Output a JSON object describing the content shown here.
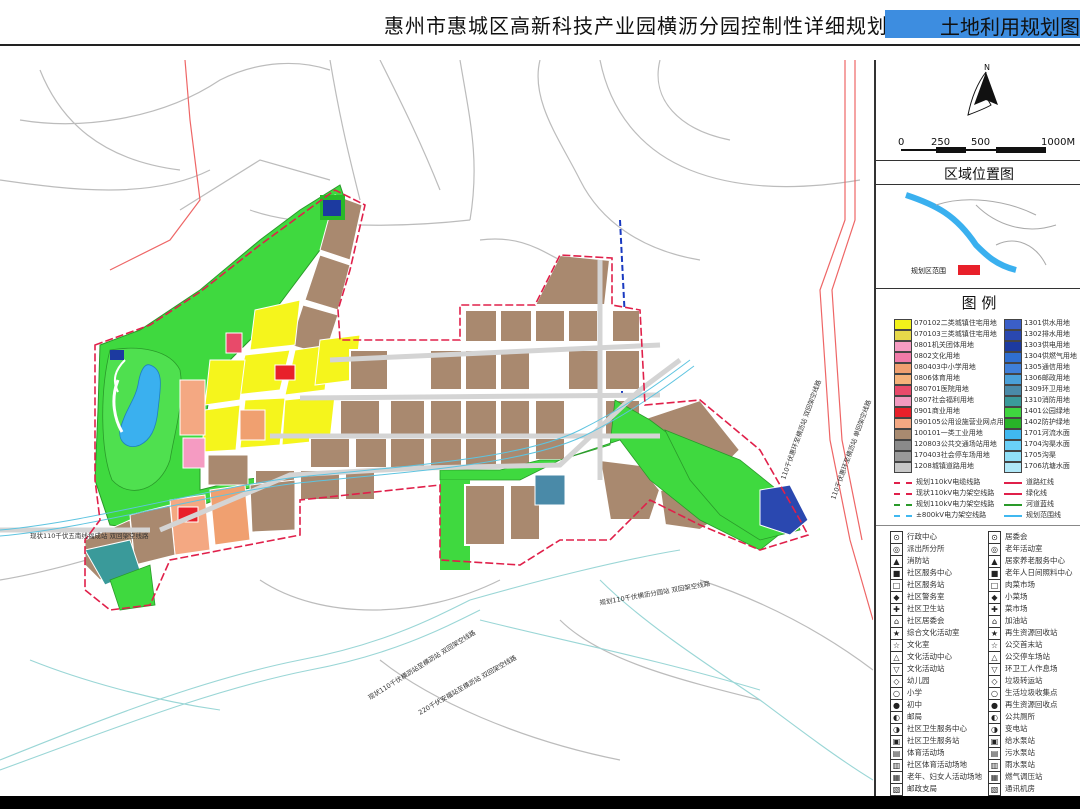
{
  "header": {
    "title": "惠州市惠城区高新科技产业园横沥分园控制性详细规划",
    "sheet_name": "土地利用规划图"
  },
  "scale": {
    "ticks": [
      "0",
      "250",
      "500",
      "1000M"
    ],
    "north_label": "N"
  },
  "location": {
    "title": "区域位置图",
    "range_label": "规划区范围"
  },
  "legend": {
    "title": "图  例",
    "left_items": [
      {
        "label": "070102二类城镇住宅用地",
        "color": "#f2f21a"
      },
      {
        "label": "070103三类城镇住宅用地",
        "color": "#e6d84a"
      },
      {
        "label": "0801机关团体用地",
        "color": "#f59bc2"
      },
      {
        "label": "0802文化用地",
        "color": "#f07aa8"
      },
      {
        "label": "080403中小学用地",
        "color": "#f0a070"
      },
      {
        "label": "0806体育用地",
        "color": "#f5b27a"
      },
      {
        "label": "080701医院用地",
        "color": "#e84a6a"
      },
      {
        "label": "0807社会福利用地",
        "color": "#f29ac0"
      },
      {
        "label": "0901商业用地",
        "color": "#e8202a"
      },
      {
        "label": "090105公用设施营业网点用地",
        "color": "#f4a882"
      },
      {
        "label": "100101一类工业用地",
        "color": "#a88a70"
      },
      {
        "label": "120803公共交通场站用地",
        "color": "#8a8a8a"
      },
      {
        "label": "170403社会停车场用地",
        "color": "#9a9a9a"
      },
      {
        "label": "1208城镇道路用地",
        "color": "#c8c8c8"
      }
    ],
    "right_items": [
      {
        "label": "1301供水用地",
        "color": "#3b5fc8"
      },
      {
        "label": "1302排水用地",
        "color": "#2a48b0"
      },
      {
        "label": "1303供电用地",
        "color": "#1c3aa0"
      },
      {
        "label": "1304供燃气用地",
        "color": "#2f6fd0"
      },
      {
        "label": "1305通信用地",
        "color": "#3f7fd8"
      },
      {
        "label": "1306邮政用地",
        "color": "#4aa0d8"
      },
      {
        "label": "1309环卫用地",
        "color": "#4a8aa8"
      },
      {
        "label": "1310消防用地",
        "color": "#3a9a9a"
      },
      {
        "label": "1401公园绿地",
        "color": "#3fd43f"
      },
      {
        "label": "1402防护绿地",
        "color": "#28b428"
      },
      {
        "label": "1701河流水面",
        "color": "#40b8f0"
      },
      {
        "label": "1704沟渠水面",
        "color": "#6ad0f8"
      },
      {
        "label": "1705沟渠",
        "color": "#90e0f8"
      },
      {
        "label": "1706坑塘水面",
        "color": "#b0e8f8"
      }
    ],
    "line_items_left": [
      "规划110kV电缆线路",
      "现状110kV电力架空线路",
      "规划110kV电力架空线路",
      "±800kV电力架空线路"
    ],
    "line_items_right": [
      "道路红线",
      "绿化线",
      "河道蓝线",
      "规划范围线"
    ],
    "symbols_left": [
      "行政中心",
      "派出所分所",
      "消防站",
      "社区服务中心",
      "社区服务站",
      "社区警务室",
      "社区卫生站",
      "社区居委会",
      "综合文化活动室",
      "文化室",
      "文化活动中心",
      "文化活动站",
      "幼儿园",
      "小学",
      "初中",
      "邮局",
      "社区卫生服务中心",
      "社区卫生服务站",
      "体育活动场",
      "社区体育活动场地",
      "老年、妇女人活动场地",
      "邮政支局"
    ],
    "symbols_right": [
      "居委会",
      "老年活动室",
      "居家养老服务中心",
      "老年人日间照料中心",
      "肉菜市场",
      "小菜场",
      "菜市场",
      "加油站",
      "再生资源回收站",
      "公交首末站",
      "公交停车场站",
      "环卫工人作息场",
      "垃圾转运站",
      "生活垃圾收集点",
      "再生资源回收点",
      "公共厕所",
      "变电站",
      "给水泵站",
      "污水泵站",
      "雨水泵站",
      "燃气调压站",
      "通讯机房"
    ]
  },
  "map_labels": {
    "road_1": "现状110千伏五南线福成站  双回架空线路",
    "road_2": "现状110千伏横沥站至横沥站  双回架空线路",
    "road_3": "220千伏安福站至横沥站  双回架空线路",
    "road_4": "规划110千伏横沥分园站  双回架空线路",
    "road_5": "110千伏惠环至横沥站  双回架空线路",
    "road_6": "110千伏惠环至横沥站  单回架空线路"
  },
  "colors": {
    "industrial": "#a9896f",
    "residential": "#f5f51c",
    "green": "#3fd93f",
    "green_dark": "#29b929",
    "water": "#3ab0ef",
    "road": "#d4d4d4",
    "boundary": "#e0204a",
    "title_box": "#3d8de0"
  }
}
